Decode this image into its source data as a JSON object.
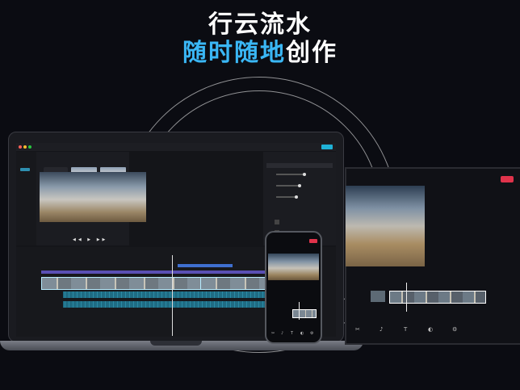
{
  "headline": {
    "line1": "行云流水",
    "line2_accent": "随时随地",
    "line2_plain": "创作"
  },
  "colors": {
    "background": "#0b0c12",
    "accent": "#3ab7f5",
    "export_button": "#1fb1d6",
    "mobile_export": "#e0334b"
  },
  "icons": {
    "window_controls": "traffic-light-dots",
    "play": "play-icon",
    "prev": "skip-back-icon",
    "next": "skip-forward-icon"
  }
}
